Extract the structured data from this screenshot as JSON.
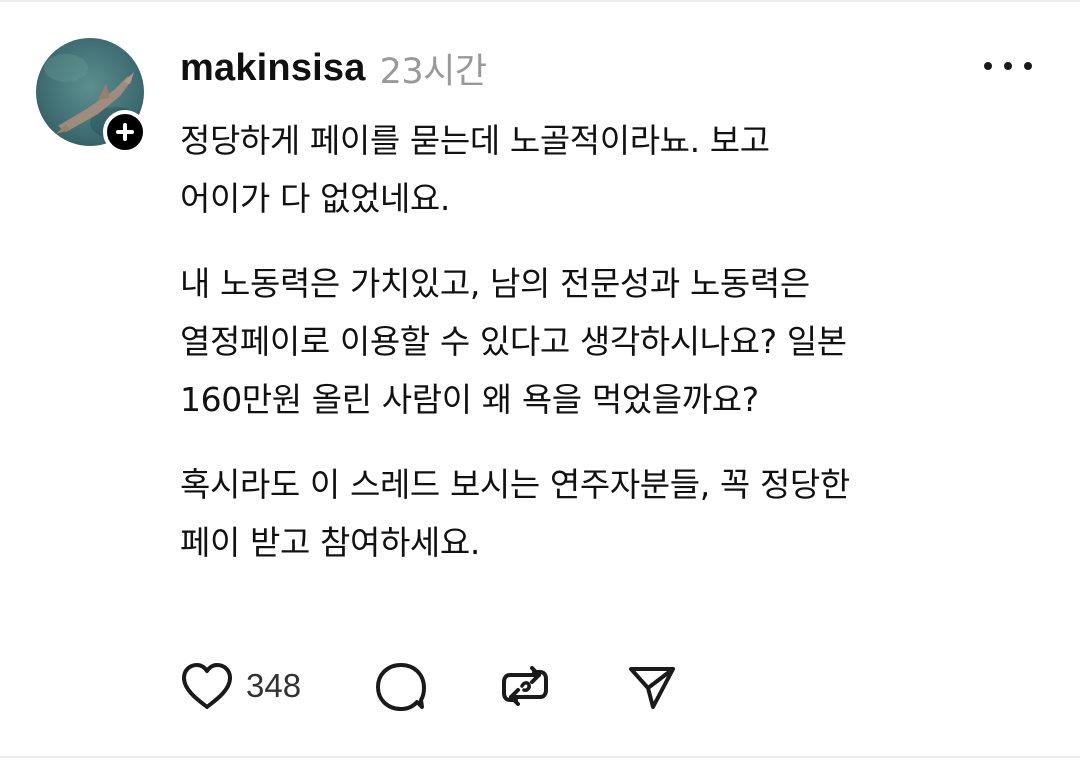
{
  "post": {
    "author": {
      "username": "makinsisa",
      "avatar_icon": "shark-photo-avatar",
      "follow_icon": "plus-icon"
    },
    "timestamp": "23시간",
    "more_icon": "more-dots-icon",
    "paragraphs": [
      {
        "lines": [
          "정당하게 페이를 묻는데 노골적이라뇨. 보고",
          "어이가 다 없었네요."
        ]
      },
      {
        "lines": [
          "내 노동력은 가치있고, 남의 전문성과 노동력은",
          "열정페이로 이용할 수 있다고 생각하시나요? 일본",
          "160만원 올린 사람이 왜 욕을 먹었을까요?"
        ]
      },
      {
        "lines": [
          "혹시라도 이 스레드 보시는 연주자분들, 꼭 정당한",
          "페이 받고 참여하세요."
        ]
      }
    ],
    "actions": {
      "like_icon": "heart-icon",
      "like_count": "348",
      "reply_icon": "comment-bubble-icon",
      "repost_icon": "repost-icon",
      "share_icon": "send-icon"
    }
  },
  "colors": {
    "text": "#101010",
    "muted": "#999999",
    "icon": "#1a1a1a",
    "badge": "#000000"
  }
}
